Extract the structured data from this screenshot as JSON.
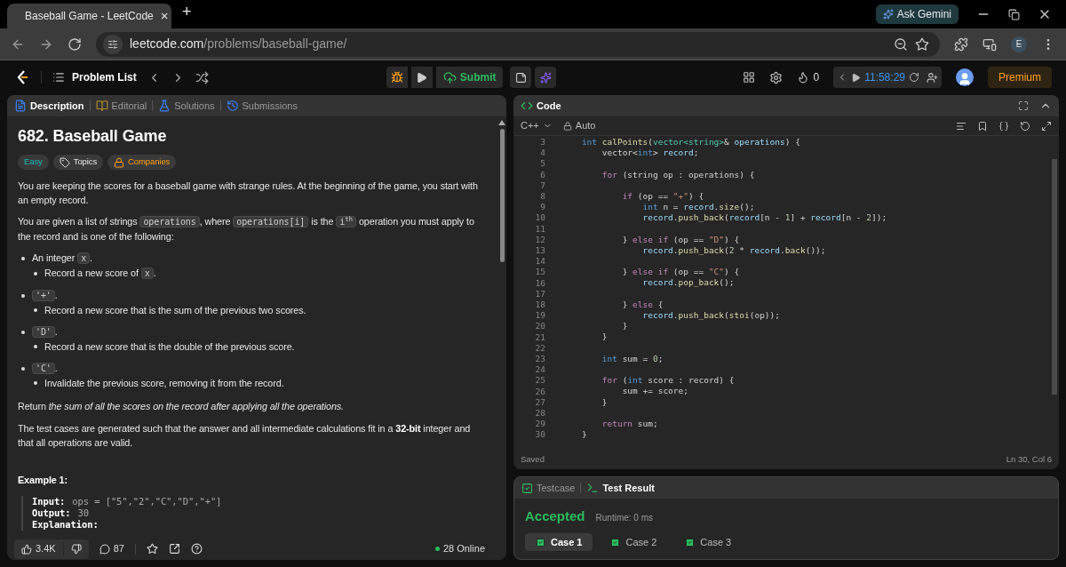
{
  "browser": {
    "tab_title": "Baseball Game - LeetCode",
    "tab_close": "×",
    "new_tab": "+",
    "gemini": "Ask Gemini",
    "url_host": "leetcode.com",
    "url_path": "/problems/baseball-game/",
    "profile": "E"
  },
  "nav": {
    "problem_list": "Problem List",
    "submit": "Submit",
    "streak": "0",
    "timer": "11:58:29",
    "premium": "Premium"
  },
  "left_tabs": [
    {
      "label": "Description",
      "selected": true,
      "kind": "description"
    },
    {
      "label": "Editorial",
      "selected": false,
      "kind": "editorial"
    },
    {
      "label": "Solutions",
      "selected": false,
      "kind": "solutions"
    },
    {
      "label": "Submissions",
      "selected": false,
      "kind": "submissions"
    }
  ],
  "problem": {
    "title": "682. Baseball Game",
    "tags": [
      {
        "label": "Easy",
        "kind": "difficulty"
      },
      {
        "label": "Topics",
        "kind": "topics"
      },
      {
        "label": "Companies",
        "kind": "companies"
      }
    ],
    "intro": [
      [
        {
          "kind": "text",
          "text": "You are keeping the scores for a baseball game with strange rules. At the beginning of the game, you start with an empty record."
        }
      ],
      [
        {
          "kind": "text",
          "text": "You are given a list of strings "
        },
        {
          "kind": "code",
          "text": "operations"
        },
        {
          "kind": "text",
          "text": ", where "
        },
        {
          "kind": "code",
          "text": "operations[i]"
        },
        {
          "kind": "text",
          "text": " is the "
        },
        {
          "kind": "code",
          "text": "i$^{th}$"
        },
        {
          "kind": "text",
          "text": " operation you must apply to the record and is one of the following:"
        }
      ]
    ],
    "list": [
      {
        "head": [
          {
            "kind": "text",
            "text": "An integer "
          },
          {
            "kind": "code",
            "text": "x"
          },
          {
            "kind": "text",
            "text": "."
          }
        ],
        "children": [
          [
            {
              "kind": "text",
              "text": "Record a new score of "
            },
            {
              "kind": "code",
              "text": "x"
            },
            {
              "kind": "text",
              "text": "."
            }
          ]
        ]
      },
      {
        "head": [
          {
            "kind": "code",
            "text": "'+'"
          },
          {
            "kind": "text",
            "text": "."
          }
        ],
        "children": [
          [
            {
              "kind": "text",
              "text": "Record a new score that is the sum of the previous two scores."
            }
          ]
        ]
      },
      {
        "head": [
          {
            "kind": "code",
            "text": "'D'"
          },
          {
            "kind": "text",
            "text": "."
          }
        ],
        "children": [
          [
            {
              "kind": "text",
              "text": "Record a new score that is the double of the previous score."
            }
          ]
        ]
      },
      {
        "head": [
          {
            "kind": "code",
            "text": "'C'"
          },
          {
            "kind": "text",
            "text": "."
          }
        ],
        "children": [
          [
            {
              "kind": "text",
              "text": "Invalidate the previous score, removing it from the record."
            }
          ]
        ]
      }
    ],
    "outro": [
      [
        {
          "kind": "text",
          "text": "Return "
        },
        {
          "kind": "italic",
          "text": "the sum of all the scores on the record after applying all the operations."
        }
      ],
      [
        {
          "kind": "text",
          "text": "The test cases are generated such that the answer and all intermediate calculations fit in a "
        },
        {
          "kind": "bold",
          "text": "32-bit"
        },
        {
          "kind": "text",
          "text": " integer and that all operations are valid."
        }
      ]
    ],
    "example": {
      "heading": "Example 1:",
      "lines": [
        {
          "label": "Input:",
          "value": "ops = [\"5\",\"2\",\"C\",\"D\",\"+\"]"
        },
        {
          "label": "Output:",
          "value": "30"
        },
        {
          "label": "Explanation:"
        }
      ]
    }
  },
  "footer": {
    "likes": "3.4K",
    "comments": "87",
    "online": "28 Online"
  },
  "editor": {
    "title": "Code",
    "language": "C++",
    "mode": "Auto",
    "status": "Saved",
    "cursor": "Ln 30, Col 6",
    "lines": [
      {
        "n": "3",
        "tokens": [
          {
            "kind": "type",
            "text": "    int"
          },
          {
            "kind": "func",
            "text": " calPoints"
          },
          {
            "kind": "plain",
            "text": "("
          },
          {
            "kind": "class",
            "text": "vector<string>"
          },
          {
            "kind": "plain",
            "text": "& "
          },
          {
            "kind": "var",
            "text": "operations"
          },
          {
            "kind": "plain",
            "text": ") {"
          }
        ]
      },
      {
        "n": "4",
        "tokens": [
          {
            "kind": "plain",
            "text": "        vector<"
          },
          {
            "kind": "type",
            "text": "int"
          },
          {
            "kind": "plain",
            "text": "> "
          },
          {
            "kind": "var",
            "text": "record"
          },
          {
            "kind": "plain",
            "text": ";"
          }
        ]
      },
      {
        "n": "5"
      },
      {
        "n": "6",
        "tokens": [
          {
            "kind": "keyword",
            "text": "        for"
          },
          {
            "kind": "plain",
            "text": " (string op : operations) {"
          }
        ]
      },
      {
        "n": "7"
      },
      {
        "n": "8",
        "tokens": [
          {
            "kind": "keyword",
            "text": "            if"
          },
          {
            "kind": "plain",
            "text": " (op == "
          },
          {
            "kind": "string",
            "text": "\"+\""
          },
          {
            "kind": "plain",
            "text": ") {"
          }
        ]
      },
      {
        "n": "9",
        "tokens": [
          {
            "kind": "type",
            "text": "                int"
          },
          {
            "kind": "plain",
            "text": " n = "
          },
          {
            "kind": "var",
            "text": "record"
          },
          {
            "kind": "plain",
            "text": "."
          },
          {
            "kind": "func",
            "text": "size"
          },
          {
            "kind": "plain",
            "text": "();"
          }
        ]
      },
      {
        "n": "10",
        "tokens": [
          {
            "kind": "var",
            "text": "                record"
          },
          {
            "kind": "plain",
            "text": "."
          },
          {
            "kind": "func",
            "text": "push_back"
          },
          {
            "kind": "plain",
            "text": "("
          },
          {
            "kind": "var",
            "text": "record"
          },
          {
            "kind": "plain",
            "text": "[n - "
          },
          {
            "kind": "number",
            "text": "1"
          },
          {
            "kind": "plain",
            "text": "] + "
          },
          {
            "kind": "var",
            "text": "record"
          },
          {
            "kind": "plain",
            "text": "[n - "
          },
          {
            "kind": "number",
            "text": "2"
          },
          {
            "kind": "plain",
            "text": "]);"
          }
        ]
      },
      {
        "n": "11"
      },
      {
        "n": "12",
        "tokens": [
          {
            "kind": "plain",
            "text": "            } "
          },
          {
            "kind": "keyword",
            "text": "else if"
          },
          {
            "kind": "plain",
            "text": " (op == "
          },
          {
            "kind": "string",
            "text": "\"D\""
          },
          {
            "kind": "plain",
            "text": ") {"
          }
        ]
      },
      {
        "n": "13",
        "tokens": [
          {
            "kind": "var",
            "text": "                record"
          },
          {
            "kind": "plain",
            "text": "."
          },
          {
            "kind": "func",
            "text": "push_back"
          },
          {
            "kind": "plain",
            "text": "("
          },
          {
            "kind": "number",
            "text": "2"
          },
          {
            "kind": "plain",
            "text": " * "
          },
          {
            "kind": "var",
            "text": "record"
          },
          {
            "kind": "plain",
            "text": "."
          },
          {
            "kind": "func",
            "text": "back"
          },
          {
            "kind": "plain",
            "text": "());"
          }
        ]
      },
      {
        "n": "14"
      },
      {
        "n": "15",
        "tokens": [
          {
            "kind": "plain",
            "text": "            } "
          },
          {
            "kind": "keyword",
            "text": "else if"
          },
          {
            "kind": "plain",
            "text": " (op == "
          },
          {
            "kind": "string",
            "text": "\"C\""
          },
          {
            "kind": "plain",
            "text": ") {"
          }
        ]
      },
      {
        "n": "16",
        "tokens": [
          {
            "kind": "var",
            "text": "                record"
          },
          {
            "kind": "plain",
            "text": "."
          },
          {
            "kind": "func",
            "text": "pop_back"
          },
          {
            "kind": "plain",
            "text": "();"
          }
        ]
      },
      {
        "n": "17"
      },
      {
        "n": "18",
        "tokens": [
          {
            "kind": "plain",
            "text": "            } "
          },
          {
            "kind": "keyword",
            "text": "else"
          },
          {
            "kind": "plain",
            "text": " {"
          }
        ]
      },
      {
        "n": "19",
        "tokens": [
          {
            "kind": "var",
            "text": "                record"
          },
          {
            "kind": "plain",
            "text": "."
          },
          {
            "kind": "func",
            "text": "push_back"
          },
          {
            "kind": "plain",
            "text": "("
          },
          {
            "kind": "func",
            "text": "stoi"
          },
          {
            "kind": "plain",
            "text": "(op));"
          }
        ]
      },
      {
        "n": "20",
        "tokens": [
          {
            "kind": "plain",
            "text": "            }"
          }
        ]
      },
      {
        "n": "21",
        "tokens": [
          {
            "kind": "plain",
            "text": "        }"
          }
        ]
      },
      {
        "n": "22"
      },
      {
        "n": "23",
        "tokens": [
          {
            "kind": "type",
            "text": "        int"
          },
          {
            "kind": "plain",
            "text": " sum = "
          },
          {
            "kind": "number",
            "text": "0"
          },
          {
            "kind": "plain",
            "text": ";"
          }
        ]
      },
      {
        "n": "24"
      },
      {
        "n": "25",
        "tokens": [
          {
            "kind": "keyword",
            "text": "        for"
          },
          {
            "kind": "plain",
            "text": " ("
          },
          {
            "kind": "type",
            "text": "int"
          },
          {
            "kind": "plain",
            "text": " score : record) {"
          }
        ]
      },
      {
        "n": "26",
        "tokens": [
          {
            "kind": "plain",
            "text": "            sum += score;"
          }
        ]
      },
      {
        "n": "27",
        "tokens": [
          {
            "kind": "plain",
            "text": "        }"
          }
        ]
      },
      {
        "n": "28"
      },
      {
        "n": "29",
        "tokens": [
          {
            "kind": "keyword",
            "text": "        return"
          },
          {
            "kind": "plain",
            "text": " sum;"
          }
        ]
      },
      {
        "n": "30",
        "tokens": [
          {
            "kind": "plain",
            "text": "    }"
          }
        ]
      }
    ]
  },
  "results": {
    "tabs": [
      {
        "label": "Testcase",
        "selected": false,
        "kind": "testcase"
      },
      {
        "label": "Test Result",
        "selected": true,
        "kind": "result"
      }
    ],
    "verdict": "Accepted",
    "runtime": "Runtime: 0 ms",
    "cases": [
      {
        "label": "Case 1",
        "selected": true,
        "passed": true
      },
      {
        "label": "Case 2",
        "selected": false,
        "passed": true
      },
      {
        "label": "Case 3",
        "selected": false,
        "passed": true
      }
    ]
  }
}
